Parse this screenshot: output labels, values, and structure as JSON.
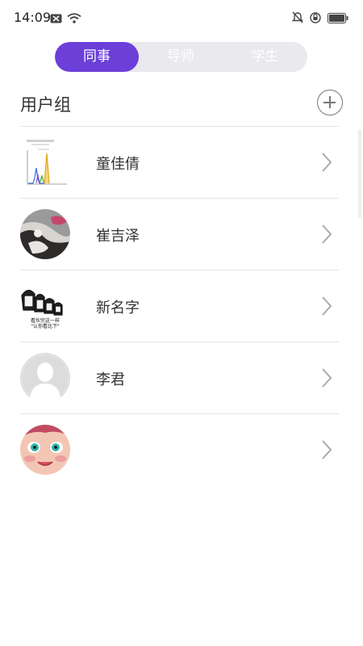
{
  "status": {
    "time": "14:09"
  },
  "tabs": [
    {
      "label": "同事",
      "active": true
    },
    {
      "label": "导师",
      "active": false
    },
    {
      "label": "学生",
      "active": false
    }
  ],
  "section": {
    "title": "用户组"
  },
  "users": [
    {
      "name": "童佳倩",
      "avatar": "chart-thumbnail-avatar"
    },
    {
      "name": "崔吉泽",
      "avatar": "photo-avatar"
    },
    {
      "name": "新名字",
      "avatar": "meme-avatar",
      "meme_caption": [
        "看伙完这一样",
        "\"认你看比下\""
      ]
    },
    {
      "name": "李君",
      "avatar": "default-user-avatar"
    },
    {
      "name": "",
      "avatar": "cartoon-face-avatar"
    }
  ],
  "colors": {
    "accent": "#6b3fd8",
    "segment_bg": "#e9e9ee",
    "divider": "#e6e6e6"
  }
}
